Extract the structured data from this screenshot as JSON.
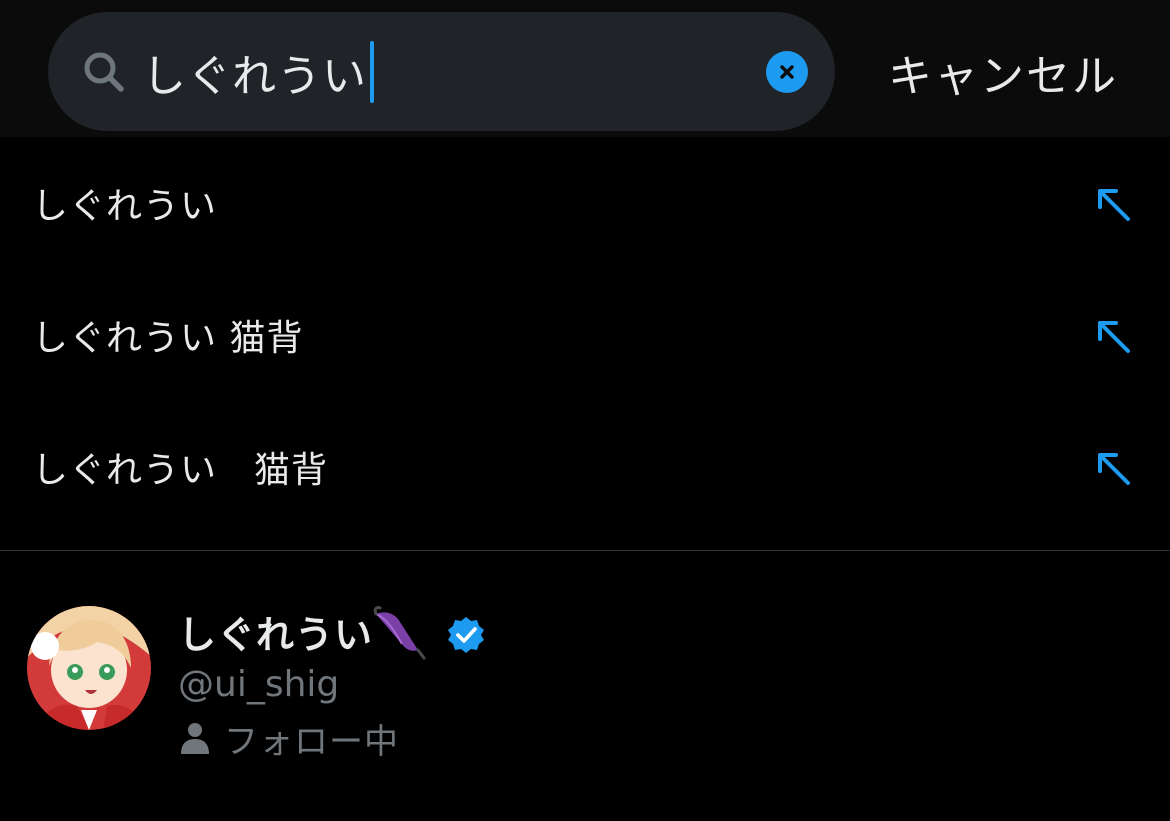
{
  "search": {
    "query": "しぐれうい",
    "cancel_label": "キャンセル"
  },
  "suggestions": [
    {
      "text": "しぐれうい"
    },
    {
      "text": "しぐれうい 猫背"
    },
    {
      "text": "しぐれうい　猫背"
    }
  ],
  "user_result": {
    "display_name": "しぐれうい",
    "handle": "@ui_shig",
    "follow_status": "フォロー中"
  },
  "colors": {
    "accent": "#1d9bf0",
    "background": "#000000",
    "topbar": "#0b0b0b",
    "search_field": "#202327",
    "primary_text": "#e7e9ea",
    "secondary_text": "#71767b",
    "divider": "#2f3336"
  },
  "icons": {
    "search": "search-icon",
    "clear": "clear-icon",
    "fill_suggestion": "arrow-up-left-icon",
    "umbrella": "umbrella-icon",
    "verified": "verified-badge-icon",
    "person": "person-icon"
  }
}
